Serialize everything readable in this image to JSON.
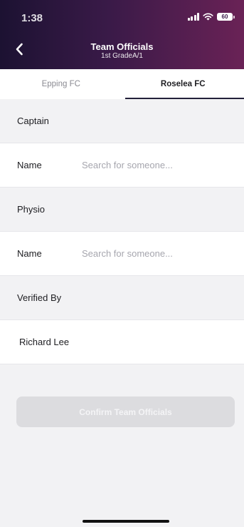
{
  "status_bar": {
    "time": "1:38",
    "battery": "60"
  },
  "header": {
    "title": "Team Officials",
    "subtitle": "1st GradeA/1"
  },
  "tabs": [
    {
      "label": "Epping FC",
      "active": false
    },
    {
      "label": "Roselea FC",
      "active": true
    }
  ],
  "sections": {
    "captain": {
      "title": "Captain",
      "field_label": "Name",
      "placeholder": "Search for someone..."
    },
    "physio": {
      "title": "Physio",
      "field_label": "Name",
      "placeholder": "Search for someone..."
    },
    "verified_by": {
      "title": "Verified By",
      "value": "Richard Lee"
    }
  },
  "confirm_button": {
    "label": "Confirm Team Officials",
    "enabled": false
  },
  "colors": {
    "header_gradient_start": "#1c1232",
    "header_gradient_end": "#6a2256",
    "active_tab_indicator": "#22203a",
    "disabled_button": "#dcdcdf"
  }
}
